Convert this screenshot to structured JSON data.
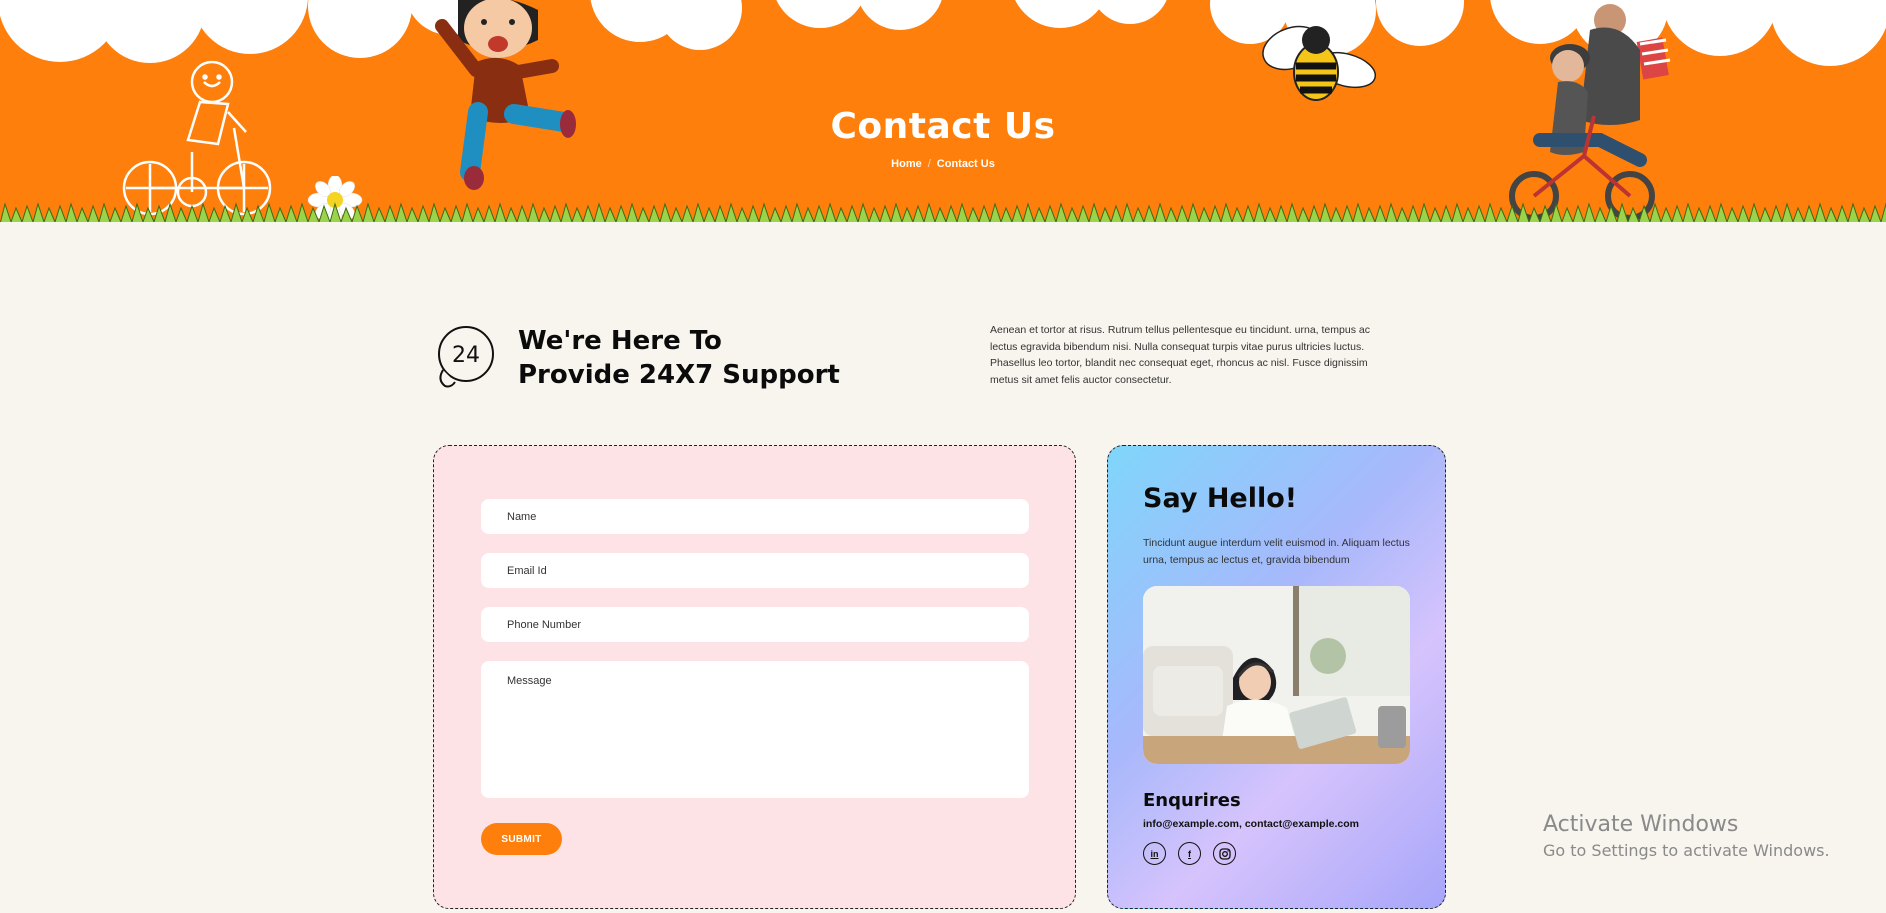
{
  "hero": {
    "title": "Contact Us",
    "breadcrumb": {
      "home": "Home",
      "separator": "/",
      "current": "Contact Us"
    },
    "background_color": "#fe7f0c",
    "grass_color": "#9bd34a"
  },
  "support": {
    "icon": "24-hour-support-icon",
    "icon_text": "24",
    "heading_line1": "We're Here To",
    "heading_line2": "Provide 24X7 Support",
    "description": "Aenean et tortor at risus. Rutrum tellus pellentesque eu tincidunt. urna, tempus ac lectus egravida bibendum nisi. Nulla consequat turpis vitae purus ultricies luctus. Phasellus leo tortor, blandit nec consequat eget, rhoncus ac nisl. Fusce dignissim metus sit amet felis auctor consectetur."
  },
  "form": {
    "name_placeholder": "Name",
    "email_placeholder": "Email Id",
    "phone_placeholder": "Phone Number",
    "message_placeholder": "Message",
    "submit_label": "SUBMIT",
    "card_color": "#fde3e6",
    "accent_color": "#fe7f0c"
  },
  "hello": {
    "title": "Say Hello!",
    "text": "Tincidunt augue interdum velit euismod in. Aliquam lectus urna, tempus ac lectus et, gravida bibendum",
    "enquiries_title": "Enqurires",
    "emails": "info@example.com, contact@example.com",
    "socials": [
      {
        "name": "linkedin-icon",
        "glyph": "in"
      },
      {
        "name": "facebook-icon",
        "glyph": "f"
      },
      {
        "name": "instagram-icon",
        "glyph": "◎"
      }
    ]
  },
  "watermark": {
    "line1": "Activate Windows",
    "line2": "Go to Settings to activate Windows."
  }
}
